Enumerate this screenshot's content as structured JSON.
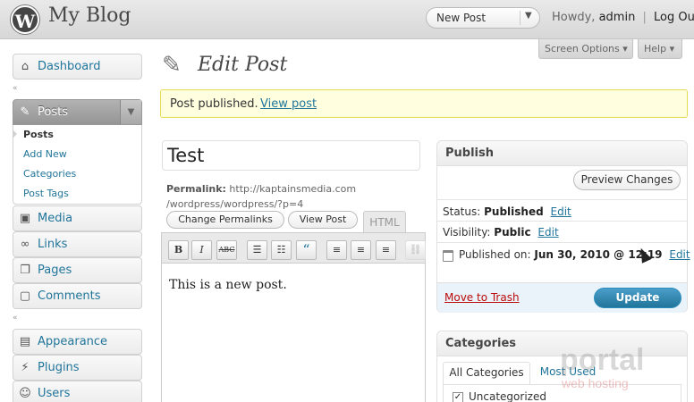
{
  "header": {
    "logo": "W",
    "site_title": "My Blog",
    "favorite_action": "New Post",
    "howdy": "Howdy,",
    "user": "admin",
    "logout": "Log Out"
  },
  "meta_tabs": {
    "screen_options": "Screen Options ▾",
    "help": "Help ▾"
  },
  "sidebar": {
    "dashboard": "Dashboard",
    "posts": "Posts",
    "posts_sub": [
      "Posts",
      "Add New",
      "Categories",
      "Post Tags"
    ],
    "items": [
      "Media",
      "Links",
      "Pages",
      "Comments"
    ],
    "items2": [
      "Appearance",
      "Plugins",
      "Users"
    ]
  },
  "page": {
    "title": "Edit Post",
    "notice": "Post published.",
    "notice_link": "View post",
    "post_title": "Test",
    "permalink_label": "Permalink:",
    "permalink_url": "http://kaptainsmedia.com /wordpress/wordpress/?p=4",
    "change_permalinks": "Change Permalinks",
    "view_post": "View Post",
    "html_tab": "HTML",
    "editor_content": "This is a new post."
  },
  "toolbar": {
    "bold": "B",
    "italic": "I",
    "strike": "ABC",
    "ul": "☰",
    "ol": "☷",
    "quote": "“",
    "al": "≡",
    "ac": "≡",
    "ar": "≡",
    "link": "⛓",
    "unlink": "⛓"
  },
  "publish": {
    "title": "Publish",
    "preview": "Preview Changes",
    "status_label": "Status:",
    "status": "Published",
    "visibility_label": "Visibility:",
    "visibility": "Public",
    "published_label": "Published on:",
    "published_on": "Jun 30, 2010 @ 12:19",
    "edit": "Edit",
    "trash": "Move to Trash",
    "update": "Update"
  },
  "categories": {
    "title": "Categories",
    "tab_all": "All Categories",
    "tab_most": "Most Used",
    "item": "Uncategorized",
    "checked": "✓"
  },
  "watermark": {
    "line1": "portal",
    "line2": "web hosting"
  }
}
